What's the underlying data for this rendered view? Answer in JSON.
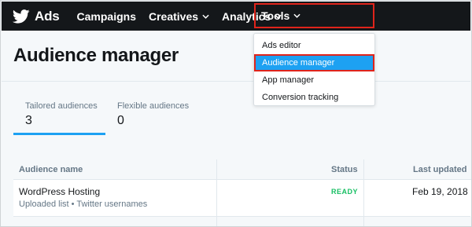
{
  "nav": {
    "brand_label": "Ads",
    "items": [
      {
        "label": "Campaigns"
      },
      {
        "label": "Creatives"
      },
      {
        "label": "Analytics"
      },
      {
        "label": "Tools"
      }
    ]
  },
  "tools_menu": {
    "items": [
      {
        "label": "Ads editor"
      },
      {
        "label": "Audience manager"
      },
      {
        "label": "App manager"
      },
      {
        "label": "Conversion tracking"
      }
    ],
    "active_index": 1
  },
  "page": {
    "title": "Audience manager"
  },
  "count_tabs": [
    {
      "label": "Tailored audiences",
      "count": "3"
    },
    {
      "label": "Flexible audiences",
      "count": "0"
    }
  ],
  "table": {
    "columns": {
      "name": "Audience name",
      "status": "Status",
      "updated": "Last updated"
    },
    "rows": [
      {
        "name": "WordPress Hosting",
        "subtitle": "Uploaded list • Twitter usernames",
        "status": "READY",
        "updated": "Feb 19, 2018"
      }
    ]
  },
  "colors": {
    "nav_bg": "#14171a",
    "accent": "#1da1f2",
    "highlight_border": "#e0241b",
    "status_ready": "#17bf63"
  },
  "icons": {
    "brand": "twitter-bird-icon",
    "dropdown": "chevron-down-icon"
  }
}
